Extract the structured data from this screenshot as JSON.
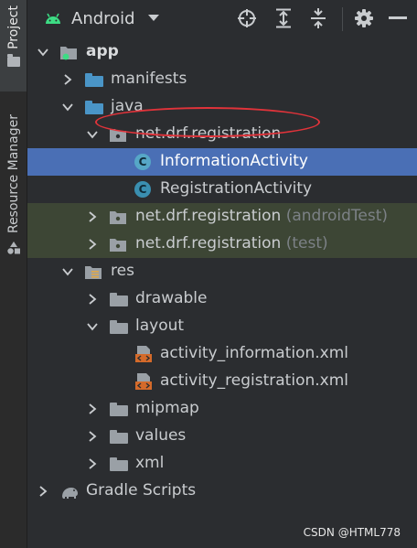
{
  "side_strip": {
    "project_tab": "Project",
    "resource_tab": "Resource Manager"
  },
  "toolbar": {
    "view_name": "Android",
    "buttons": [
      "locate-icon",
      "expand-all-icon",
      "collapse-all-icon",
      "gear-icon",
      "minimize-icon"
    ]
  },
  "tree": {
    "app": "app",
    "manifests": "manifests",
    "java": "java",
    "pkg_main": "net.drf.registration",
    "info_activity": "InformationActivity",
    "reg_activity": "RegistrationActivity",
    "pkg_android_test": "net.drf.registration",
    "pkg_android_test_suffix": "(androidTest)",
    "pkg_test": "net.drf.registration",
    "pkg_test_suffix": "(test)",
    "res": "res",
    "drawable": "drawable",
    "layout": "layout",
    "layout_info": "activity_information.xml",
    "layout_reg": "activity_registration.xml",
    "mipmap": "mipmap",
    "values": "values",
    "xml": "xml",
    "gradle": "Gradle Scripts"
  },
  "colors": {
    "selection": "#4a6fb5",
    "test_row": "#3d4635",
    "folder_blue": "#4a95c7",
    "folder_gray": "#9aa0a6",
    "class_badge": "#3a8fb0",
    "annotation": "#e0333a"
  },
  "watermark": "CSDN @HTML778"
}
